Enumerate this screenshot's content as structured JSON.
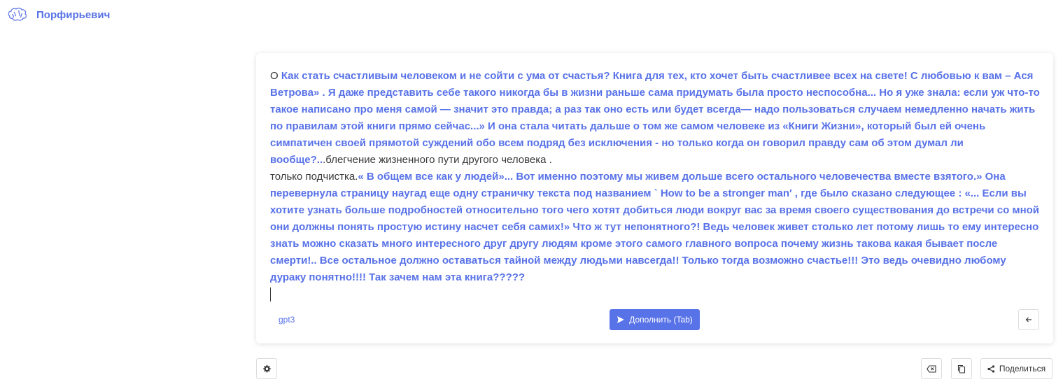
{
  "header": {
    "app_name": "Порфирьевич",
    "logo_icon": "brain-icon"
  },
  "editor": {
    "segments": [
      {
        "type": "user",
        "text": "О "
      },
      {
        "type": "gen",
        "text": "Как стать счастливым человеком и не сойти с ума от счастья? Книга для тех, кто хочет быть счастливее всех на свете! С любовью к вам – Ася Ветрова» . Я даже представить себе такого никогда бы в жизни раньше сама придумать была просто неспособна... Но я уже знала: если уж что-то такое написано про меня самой — значит это правда; а раз так оно есть или будет всегда— надо пользоваться случаем немедленно начать жить по правилам этой книги прямо сейчас...» И она стала читать дальше о том же самом человеке из «Книги Жизни», который был ей очень симпатичен своей прямотой суждений обо всем подряд без исключения - но только когда он говорил правду сам об этом думал ли вообще?.."
      },
      {
        "type": "user",
        "text": "."
      },
      {
        "type": "user",
        "text": "блегчение жизненного пути другого человека ."
      },
      {
        "type": "user",
        "text": "только подчистка."
      },
      {
        "type": "gen",
        "text": "« В общем все как у людей»... Вот именно поэтому мы живем дольше всего остального человечества вместе взятого.» Она перевернула страницу наугад еще одну страничку текста под названием ` How to be a stronger man′ , где было сказано следующее : «... Если вы хотите узнать больше подробностей относительно того чего хотят добиться люди вокруг вас за время своего существования до встречи со мной они должны понять простую истину насчет себя самих!» Что ж тут непонятного?! Ведь человек живет столько лет потому лишь то ему интересно знать можно сказать много интересного друг другу людям кроме этого самого главного вопроса почему жизнь такова какая бывает после смерти!.. Все остальное должно оставаться тайной между людьми навсегда!! Только тогда возможно счастье!!! Это ведь очевидно любому дураку понятно!!!! Так зачем нам эта книга?????"
      }
    ]
  },
  "controls": {
    "model_label": "gpt3",
    "complete_label": "Дополнить (Tab)",
    "complete_icon": "send-icon",
    "back_icon": "arrow-left-icon",
    "settings_icon": "gear-icon",
    "clear_icon": "backspace-icon",
    "copy_icon": "copy-icon",
    "share_label": "Поделиться",
    "share_icon": "share-icon"
  },
  "colors": {
    "accent": "#5872e8",
    "text": "#3a3a3a",
    "border": "#dcdcdc"
  }
}
